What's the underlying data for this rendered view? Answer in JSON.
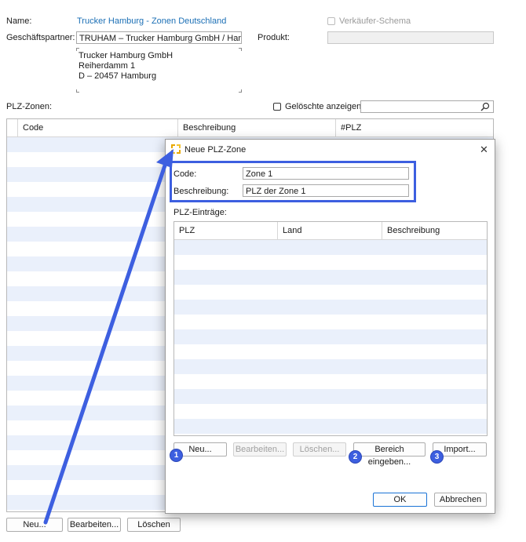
{
  "main": {
    "name_label": "Name:",
    "name_value": "Trucker Hamburg - Zonen Deutschland",
    "seller_schema_label": "Verkäufer-Schema",
    "partner_label": "Geschäftspartner:",
    "partner_value": "TRUHAM – Trucker Hamburg GmbH / Hambu",
    "product_label": "Produkt:",
    "product_value": "",
    "address": {
      "line1": "Trucker Hamburg GmbH",
      "line2": "Reiherdamm 1",
      "line3": "D – 20457 Hamburg"
    },
    "zones_label": "PLZ-Zonen:",
    "show_deleted_label": "Gelöschte anzeigen",
    "search_value": "",
    "columns": [
      "Code",
      "Beschreibung",
      "#PLZ"
    ],
    "buttons": {
      "new": "Neu...",
      "edit": "Bearbeiten...",
      "delete": "Löschen"
    }
  },
  "dialog": {
    "title": "Neue PLZ-Zone",
    "close_glyph": "✕",
    "code_label": "Code:",
    "code_value": "Zone 1",
    "desc_label": "Beschreibung:",
    "desc_value": "PLZ der Zone 1",
    "entries_label": "PLZ-Einträge:",
    "columns": [
      "PLZ",
      "Land",
      "Beschreibung"
    ],
    "buttons": {
      "new": "Neu...",
      "edit": "Bearbeiten...",
      "delete": "Löschen...",
      "range": "Bereich eingeben...",
      "import": "Import...",
      "ok": "OK",
      "cancel": "Abbrechen"
    }
  },
  "annotations": {
    "badge1": "1",
    "badge2": "2",
    "badge3": "3"
  },
  "colors": {
    "accent": "#3d5fe0",
    "link": "#1b6fb5",
    "row_stripe": "#eaf0fb"
  },
  "icons": {
    "search": "search-icon",
    "app": "app-icon",
    "close": "close-icon"
  }
}
